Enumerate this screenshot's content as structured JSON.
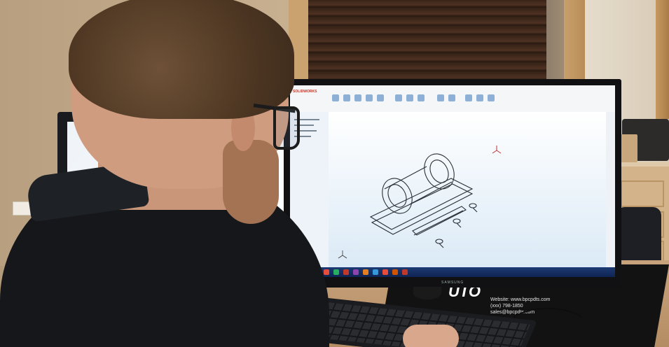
{
  "scene": {
    "description_hidden": "",
    "cad_window_title": "SOLIDWORKS",
    "monitor_brand": "SAMSUNG",
    "mat_logo": "UTO",
    "mat_lines": [
      "Website: www.bpcpdts.com",
      "(xxx) 798-1850",
      "sales@bpcpdts.com"
    ]
  },
  "colors": {
    "cad_background_top": "#ffffff",
    "cad_background_bottom": "#dbeaf6",
    "taskbar": "#1c3a73",
    "shirt": "#15171b",
    "hair": "#4d3622",
    "desk": "#c7a27a"
  }
}
